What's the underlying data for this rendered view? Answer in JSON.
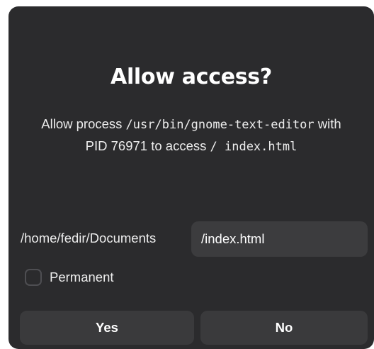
{
  "dialog": {
    "title": "Allow access?",
    "message": {
      "text_1": "Allow process ",
      "process_path": "/usr/bin/gnome-text-editor",
      "text_2": " with PID 76971 to access ",
      "target_path": "/ index.html"
    },
    "directory": "/home/fedir/Documents",
    "file_name_value": "/index.html",
    "permanent_label": "Permanent",
    "permanent_checked": false,
    "yes_label": "Yes",
    "no_label": "No"
  }
}
